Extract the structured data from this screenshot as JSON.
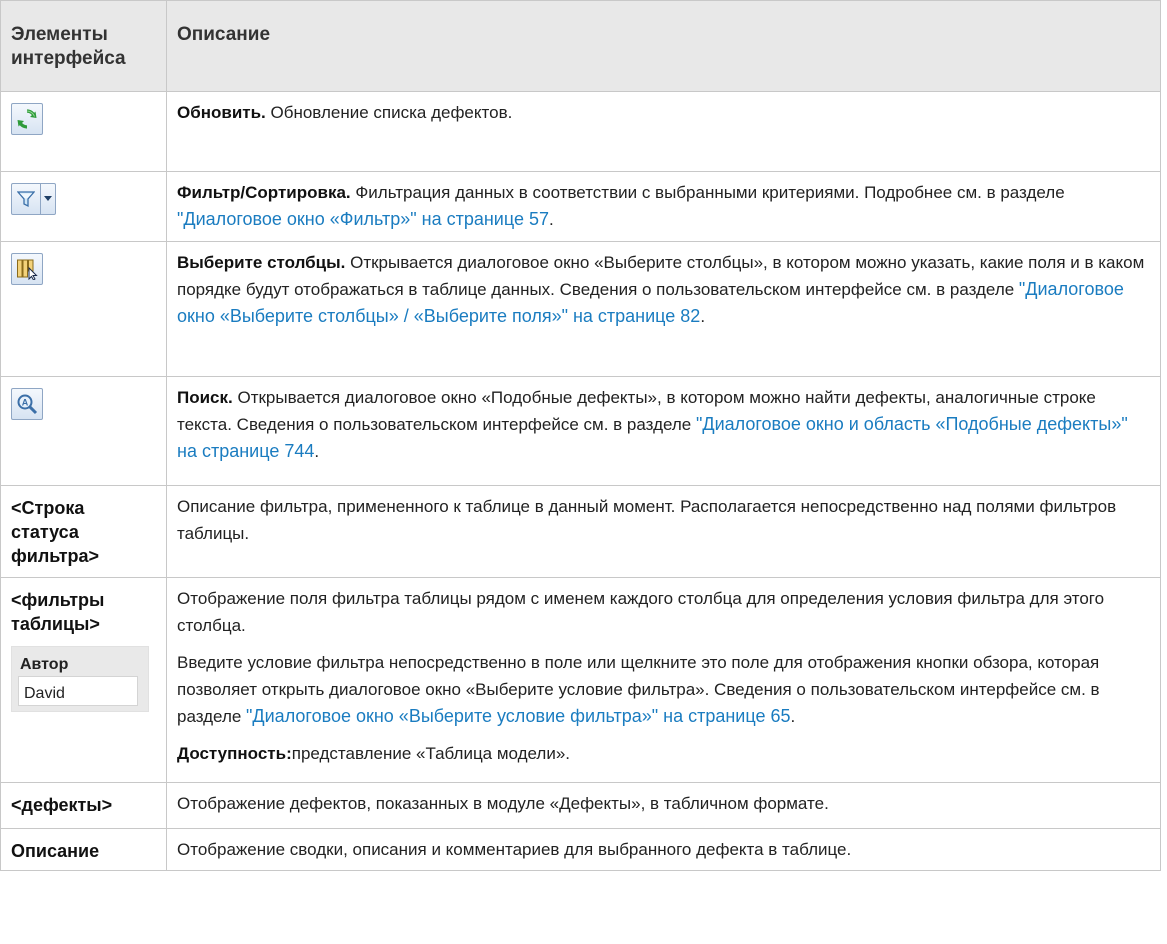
{
  "header": {
    "col1": "Элементы интерфейса",
    "col2": "Описание"
  },
  "rows": [
    {
      "icon": "refresh-icon",
      "title": "Обновить.",
      "text": " Обновление списка дефектов."
    },
    {
      "icon": "filter-sort-icon",
      "title": "Фильтр/Сортировка.",
      "text": " Фильтрация данных в соответствии с выбранными критериями. Подробнее см. в разделе ",
      "link": "\"Диалоговое окно «Фильтр»\" на странице 57",
      "end": "."
    },
    {
      "icon": "select-columns-icon",
      "title": "Выберите столбцы.",
      "text": " Открывается диалоговое окно «Выберите столбцы», в котором можно указать, какие поля и в каком порядке будут отображаться в таблице данных. Сведения о пользовательском интерфейсе см. в разделе ",
      "link": "\"Диалоговое окно «Выберите столбцы» / «Выберите поля»\" на странице 82",
      "end": "."
    },
    {
      "icon": "search-icon",
      "title": "Поиск.",
      "text": " Открывается диалоговое окно «Подобные дефекты», в котором можно найти дефекты, аналогичные строке текста. Сведения о пользовательском интерфейсе см. в разделе ",
      "link": "\"Диалоговое окно и область «Подобные дефекты»\" на странице 744",
      "end": "."
    },
    {
      "label": "<Строка статуса фильтра>",
      "text": "Описание фильтра, примененного к таблице в данный момент. Располагается непосредственно над полями фильтров таблицы."
    },
    {
      "label": "<фильтры таблицы>",
      "sample_header": "Автор",
      "sample_value": "David",
      "p1": "Отображение поля фильтра таблицы рядом с именем каждого столбца для определения условия фильтра для этого столбца.",
      "p2": "Введите условие фильтра непосредственно в поле или щелкните это поле для отображения кнопки обзора, которая позволяет открыть диалоговое окно «Выберите условие фильтра». Сведения о пользовательском интерфейсе см. в разделе ",
      "p2_link": "\"Диалоговое окно «Выберите условие фильтра»\" на странице 65",
      "p2_end": ".",
      "p3_bold": "Доступность:",
      "p3_text": "представление «Таблица модели»."
    },
    {
      "label": "<дефекты>",
      "text": "Отображение дефектов, показанных в модуле «Дефекты», в табличном формате."
    },
    {
      "label": "Описание",
      "text": "Отображение сводки, описания и комментариев для выбранного дефекта в таблице."
    }
  ]
}
